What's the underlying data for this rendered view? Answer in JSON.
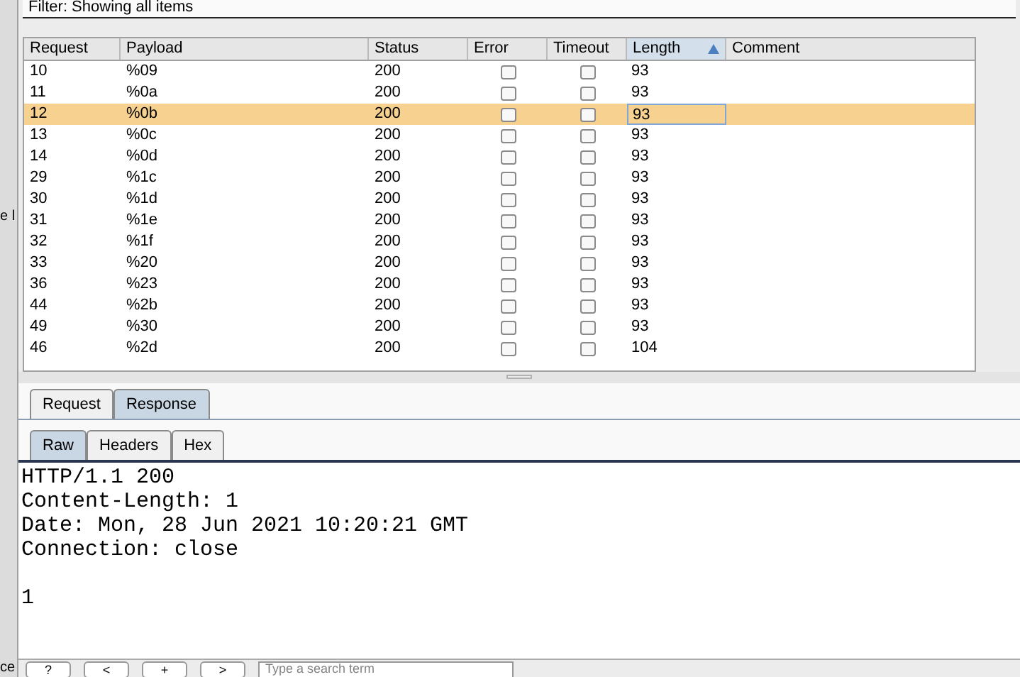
{
  "filter": "Filter: Showing all items",
  "left_fragments": [
    "e l",
    "ce"
  ],
  "table": {
    "columns": [
      {
        "label": "Request",
        "sorted": false
      },
      {
        "label": "Payload",
        "sorted": false
      },
      {
        "label": "Status",
        "sorted": false
      },
      {
        "label": "Error",
        "sorted": false
      },
      {
        "label": "Timeout",
        "sorted": false
      },
      {
        "label": "Length",
        "sorted": true
      },
      {
        "label": "Comment",
        "sorted": false
      }
    ],
    "rows": [
      {
        "request": "10",
        "payload": "%09",
        "status": "200",
        "error": false,
        "timeout": false,
        "length": "93",
        "selected": false
      },
      {
        "request": "11",
        "payload": "%0a",
        "status": "200",
        "error": false,
        "timeout": false,
        "length": "93",
        "selected": false
      },
      {
        "request": "12",
        "payload": "%0b",
        "status": "200",
        "error": false,
        "timeout": false,
        "length": "93",
        "selected": true
      },
      {
        "request": "13",
        "payload": "%0c",
        "status": "200",
        "error": false,
        "timeout": false,
        "length": "93",
        "selected": false
      },
      {
        "request": "14",
        "payload": "%0d",
        "status": "200",
        "error": false,
        "timeout": false,
        "length": "93",
        "selected": false
      },
      {
        "request": "29",
        "payload": "%1c",
        "status": "200",
        "error": false,
        "timeout": false,
        "length": "93",
        "selected": false
      },
      {
        "request": "30",
        "payload": "%1d",
        "status": "200",
        "error": false,
        "timeout": false,
        "length": "93",
        "selected": false
      },
      {
        "request": "31",
        "payload": "%1e",
        "status": "200",
        "error": false,
        "timeout": false,
        "length": "93",
        "selected": false
      },
      {
        "request": "32",
        "payload": "%1f",
        "status": "200",
        "error": false,
        "timeout": false,
        "length": "93",
        "selected": false
      },
      {
        "request": "33",
        "payload": "%20",
        "status": "200",
        "error": false,
        "timeout": false,
        "length": "93",
        "selected": false
      },
      {
        "request": "36",
        "payload": "%23",
        "status": "200",
        "error": false,
        "timeout": false,
        "length": "93",
        "selected": false
      },
      {
        "request": "44",
        "payload": "%2b",
        "status": "200",
        "error": false,
        "timeout": false,
        "length": "93",
        "selected": false
      },
      {
        "request": "49",
        "payload": "%30",
        "status": "200",
        "error": false,
        "timeout": false,
        "length": "93",
        "selected": false
      },
      {
        "request": "46",
        "payload": "%2d",
        "status": "200",
        "error": false,
        "timeout": false,
        "length": "104",
        "selected": false
      }
    ]
  },
  "message_tabs": [
    {
      "label": "Request",
      "selected": false
    },
    {
      "label": "Response",
      "selected": true
    }
  ],
  "view_tabs": [
    {
      "label": "Raw",
      "selected": true
    },
    {
      "label": "Headers",
      "selected": false
    },
    {
      "label": "Hex",
      "selected": false
    }
  ],
  "response_headers": [
    "HTTP/1.1 200",
    "Content-Length: 1",
    "Date: Mon, 28 Jun 2021 10:20:21 GMT",
    "Connection: close"
  ],
  "response_body": [
    "1"
  ],
  "search": {
    "buttons": [
      "?",
      "<",
      "+",
      ">"
    ],
    "placeholder": "Type a search term"
  }
}
